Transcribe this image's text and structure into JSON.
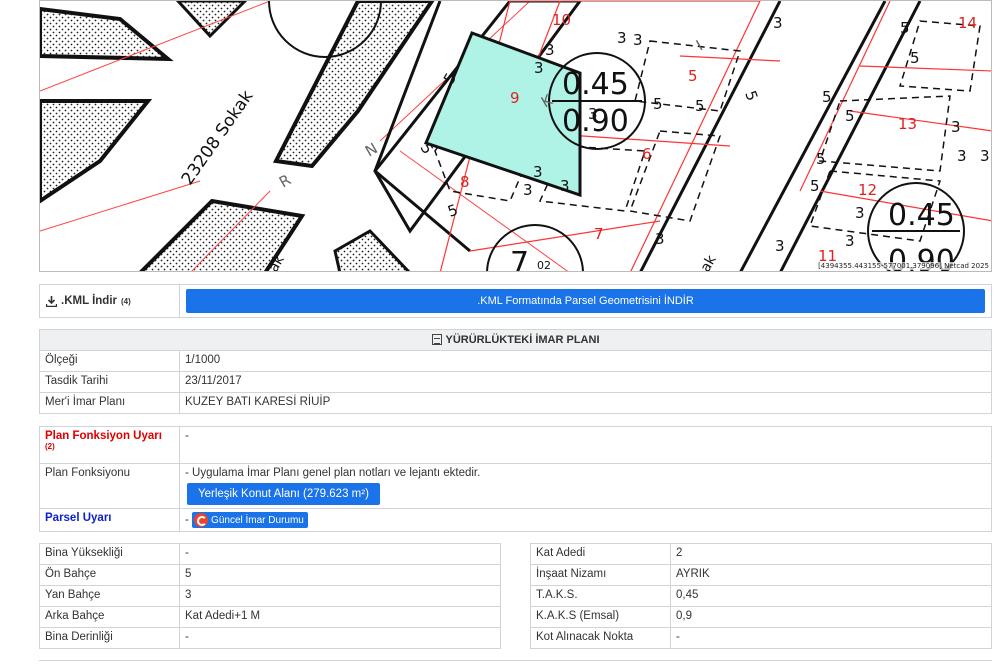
{
  "map": {
    "parcels": [
      "10",
      "14",
      "5",
      "9",
      "13",
      "6",
      "8",
      "12",
      "7",
      "11"
    ],
    "street_label": "23208 Sokak",
    "street_letters": [
      "N",
      "R",
      "K",
      "I"
    ],
    "setbacks": [
      "3",
      "5",
      "3",
      "3",
      "5",
      "5",
      "3",
      "5",
      "3",
      "3",
      "5",
      "5",
      "3",
      "3",
      "3",
      "3",
      "5",
      "5",
      "3",
      "5",
      "5",
      "3",
      "5",
      "3",
      "3",
      "3",
      "5",
      "3"
    ],
    "density_a": {
      "taks": "0.45",
      "kaks": "0.90"
    },
    "density_b": {
      "taks": "0.45",
      "kaks": "0.90"
    },
    "density_c": {
      "taks": "7",
      "kaks": "02"
    },
    "partial_label": "ak",
    "partial_label_2": "ak",
    "attribution": "[4394355.443155-577001.379096] Netcad 2025",
    "colors": {
      "selected_parcel": "#aef3e6",
      "parcel_line": "#ff3333",
      "hatch": "#222222"
    }
  },
  "kml": {
    "label": ".KML İndir",
    "note": "(4)",
    "button": ".KML Formatında Parsel Geometrisini İNDİR"
  },
  "imar": {
    "title": "YÜRÜRLÜKTEKİ İMAR PLANI",
    "rows": [
      {
        "label": "Ölçeği",
        "value": "1/1000"
      },
      {
        "label": "Tasdik Tarihi",
        "value": "23/11/2017"
      },
      {
        "label": "Mer'i İmar Planı",
        "value": "KUZEY BATI KARESİ RİUİP"
      }
    ]
  },
  "plan": {
    "uyari_label": "Plan Fonksiyon Uyarı",
    "uyari_note": "(2)",
    "uyari_value": "-",
    "fonksiyon_label": "Plan Fonksiyonu",
    "fonksiyon_text": "- Uygulama İmar Planı genel plan notları ve lejantı ektedir.",
    "fonksiyon_button": "Yerleşik Konut Alanı (279.623 m²)",
    "parsel_label": "Parsel Uyarı",
    "parsel_dash": "-",
    "parsel_button": "Güncel İmar Durumu"
  },
  "left_table": [
    {
      "label": "Bina Yüksekliği",
      "value": "-"
    },
    {
      "label": "Ön Bahçe",
      "value": "5"
    },
    {
      "label": "Yan Bahçe",
      "value": "3"
    },
    {
      "label": "Arka Bahçe",
      "value": "Kat Adedi+1 M"
    },
    {
      "label": "Bina Derinliği",
      "value": "-"
    }
  ],
  "right_table": [
    {
      "label": "Kat Adedi",
      "value": "2"
    },
    {
      "label": "İnşaat Nizamı",
      "value": "AYRIK"
    },
    {
      "label": "T.A.K.S.",
      "value": "0,45"
    },
    {
      "label": "K.A.K.S (Emsal)",
      "value": "0,9"
    },
    {
      "label": "Kot Alınacak Nokta",
      "value": "-"
    }
  ]
}
